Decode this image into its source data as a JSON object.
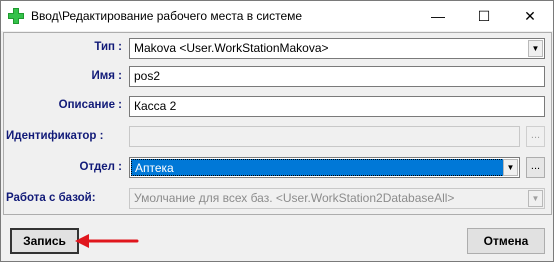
{
  "window": {
    "title": "Ввод\\Редактирование рабочего места в системе",
    "controls": {
      "minimize": "—",
      "maximize": "☐",
      "close": "✕"
    }
  },
  "form": {
    "type": {
      "label": "Тип :",
      "value": "Makova  <User.WorkStationMakova>"
    },
    "name": {
      "label": "Имя :",
      "value": "pos2"
    },
    "description": {
      "label": "Описание :",
      "value": "Касса 2"
    },
    "identifier": {
      "label": "Идентификатор :",
      "value": "",
      "button": "..."
    },
    "department": {
      "label": "Отдел :",
      "value": "Аптека",
      "button": "..."
    },
    "database": {
      "label": "Работа с базой:",
      "value": "Умолчание для всех баз.  <User.WorkStation2DatabaseAll>"
    }
  },
  "buttons": {
    "save": "Запись",
    "cancel": "Отмена"
  },
  "colors": {
    "label": "#111a78",
    "selection": "#0078d7",
    "annotation_arrow": "#e0161d"
  },
  "icons": {
    "app": "green-plus-icon",
    "dropdown": "chevron-down-icon",
    "annotation": "red-arrow-icon"
  }
}
